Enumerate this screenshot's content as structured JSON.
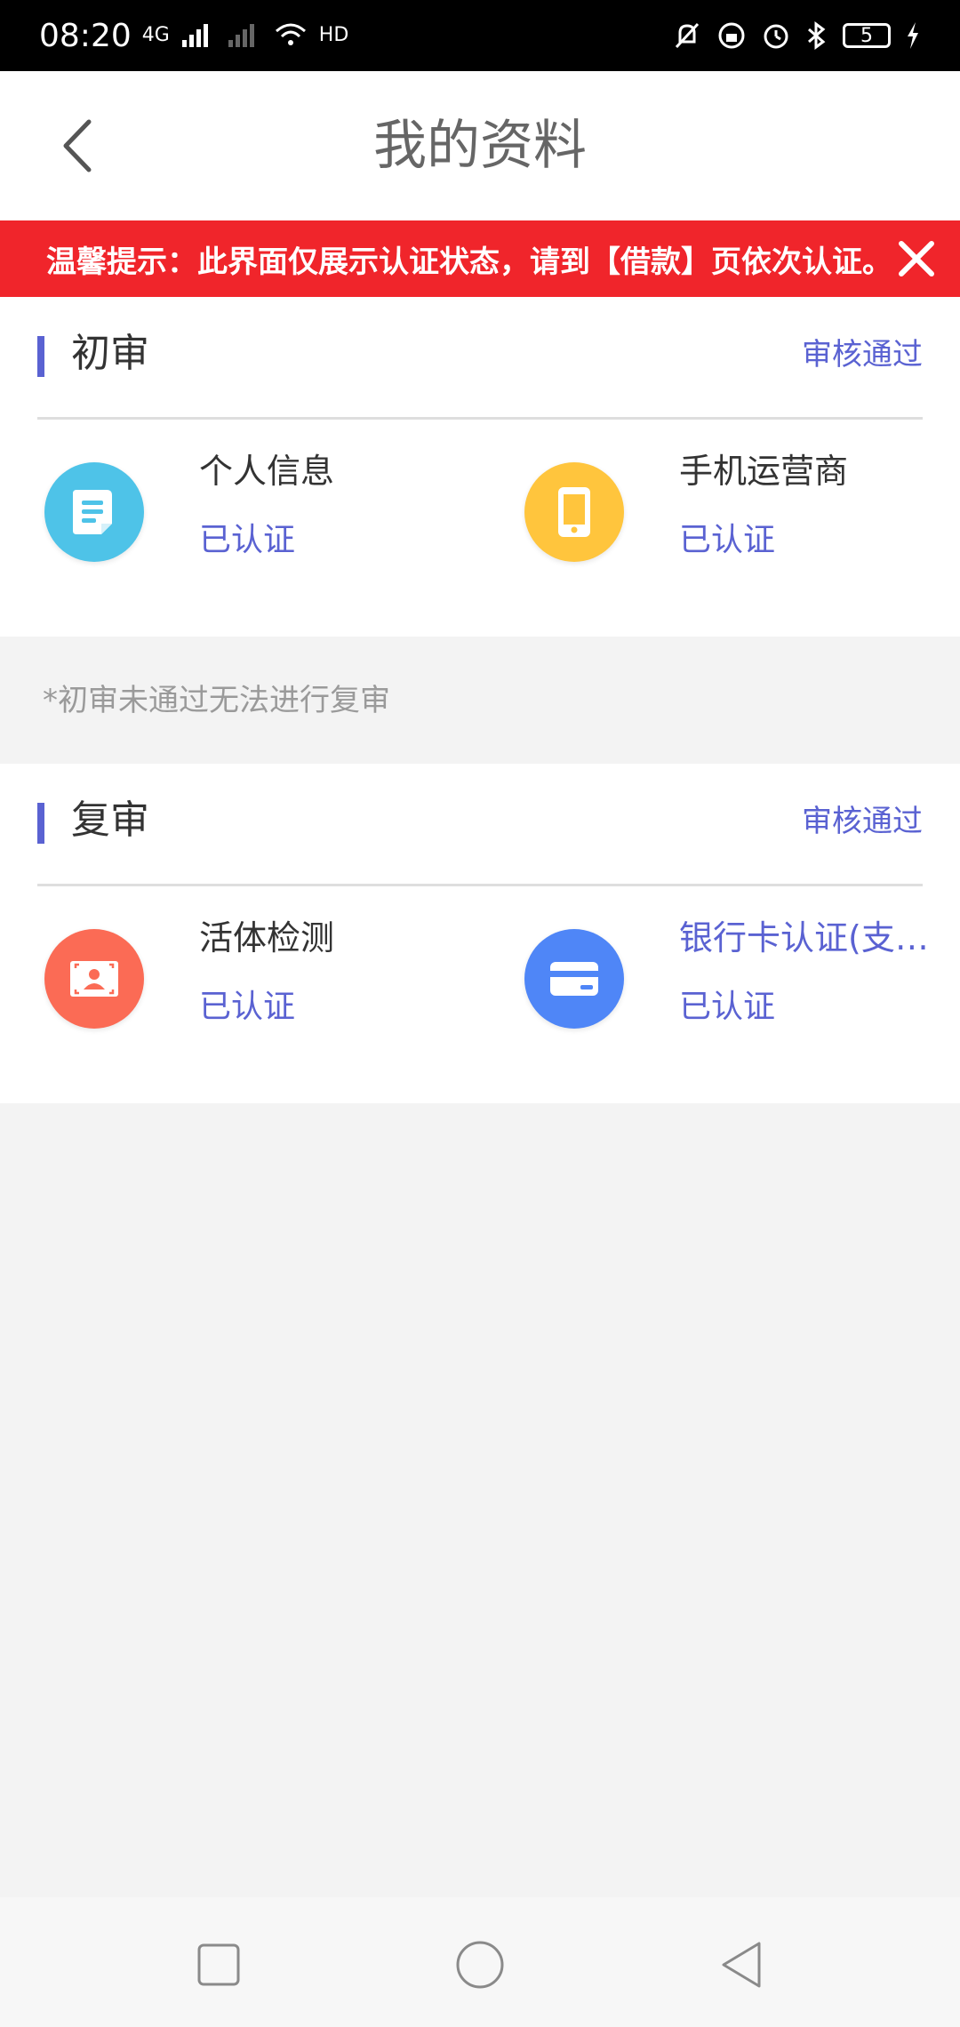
{
  "status_bar": {
    "time": "08:20",
    "network": "4G",
    "hd": "HD",
    "battery": "5"
  },
  "header": {
    "title": "我的资料"
  },
  "notice": {
    "text": "温馨提示：此界面仅展示认证状态，请到【借款】页依次认证。"
  },
  "sections": [
    {
      "title": "初审",
      "status": "审核通过",
      "items": [
        {
          "title": "个人信息",
          "status": "已认证",
          "icon": "document-icon",
          "color": "#4ec3e8"
        },
        {
          "title": "手机运营商",
          "status": "已认证",
          "icon": "phone-icon",
          "color": "#ffc53d"
        }
      ]
    },
    {
      "title": "复审",
      "status": "审核通过",
      "items": [
        {
          "title": "活体检测",
          "status": "已认证",
          "icon": "face-scan-icon",
          "color": "#fb6b55"
        },
        {
          "title": "银行卡认证(支持...",
          "status": "已认证",
          "icon": "bank-card-icon",
          "color": "#4f86f7"
        }
      ]
    }
  ],
  "note": "*初审未通过无法进行复审",
  "colors": {
    "accent": "#5a62d2",
    "notice_bg": "#f0252b"
  }
}
